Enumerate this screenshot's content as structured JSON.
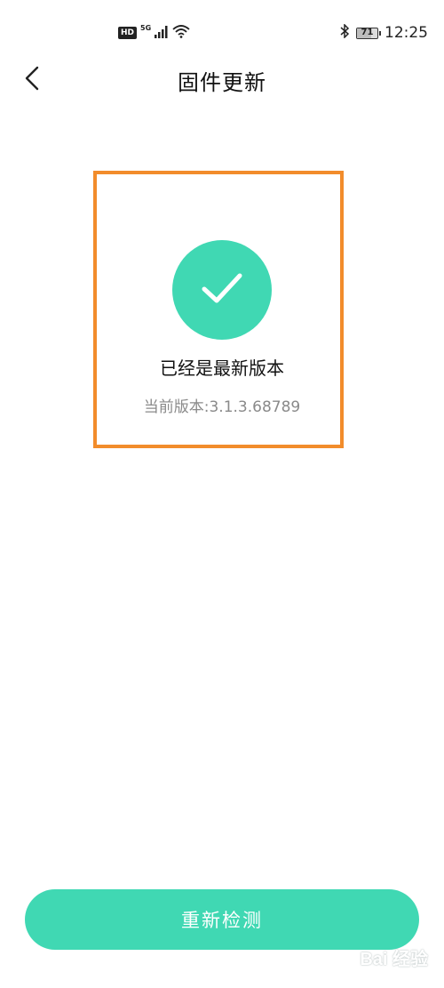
{
  "status_bar": {
    "hd_badge": "HD",
    "network_type": "5G",
    "battery_level": "71",
    "time": "12:25"
  },
  "header": {
    "title": "固件更新",
    "back_icon": "chevron-left-icon"
  },
  "update_status": {
    "icon": "check-icon",
    "title": "已经是最新版本",
    "current_version": "当前版本:3.1.3.68789"
  },
  "actions": {
    "recheck_label": "重新检测"
  },
  "watermark": {
    "text": "Bai 经验"
  },
  "colors": {
    "accent": "#40d8b3",
    "highlight_border": "#f28c2b",
    "version_text": "#8a8a8a"
  }
}
